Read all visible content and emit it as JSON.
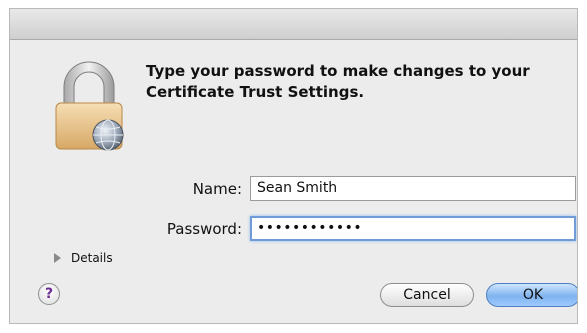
{
  "dialog": {
    "message": "Type your password to make changes to your Certificate Trust Settings."
  },
  "form": {
    "name_label": "Name:",
    "name_value": "Sean Smith",
    "password_label": "Password:",
    "password_value": "••••••••••••"
  },
  "details_label": "Details",
  "help_label": "?",
  "buttons": {
    "cancel": "Cancel",
    "ok": "OK"
  },
  "icons": {
    "lock": "lock-with-globe-icon",
    "disclosure": "disclosure-triangle-icon",
    "help": "help-icon"
  },
  "colors": {
    "focus_ring": "#6f9bd9",
    "default_button": "#7fb3ee",
    "help_glyph": "#6b2c91"
  }
}
